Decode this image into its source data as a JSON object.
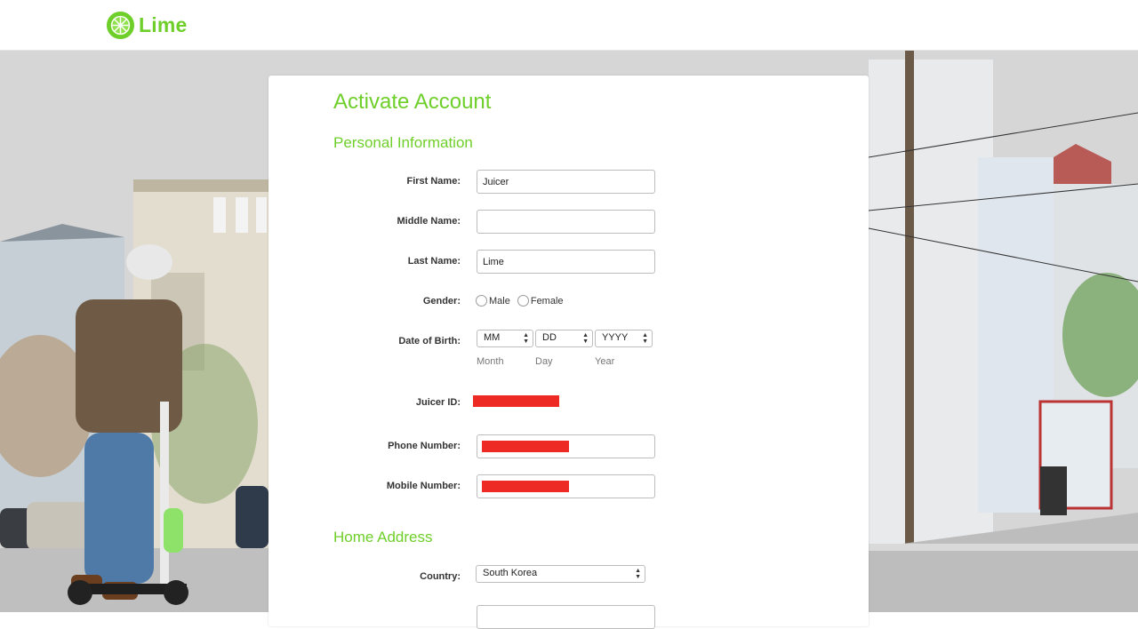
{
  "brand": {
    "name": "Lime",
    "accent": "#6fcf2a"
  },
  "form": {
    "title": "Activate Account",
    "personal_section": "Personal Information",
    "home_section": "Home Address",
    "fields": {
      "first_name": {
        "label": "First Name:",
        "value": "Juicer"
      },
      "middle_name": {
        "label": "Middle Name:",
        "value": ""
      },
      "last_name": {
        "label": "Last Name:",
        "value": "Lime"
      },
      "gender": {
        "label": "Gender:",
        "options": [
          "Male",
          "Female"
        ]
      },
      "dob": {
        "label": "Date of Birth:",
        "month": "MM",
        "day": "DD",
        "year": "YYYY",
        "month_caption": "Month",
        "day_caption": "Day",
        "year_caption": "Year"
      },
      "juicer_id": {
        "label": "Juicer ID:"
      },
      "phone": {
        "label": "Phone Number:"
      },
      "mobile": {
        "label": "Mobile Number:"
      },
      "country": {
        "label": "Country:",
        "value": "South Korea"
      }
    }
  },
  "colors": {
    "redaction": "#ee2a24"
  }
}
